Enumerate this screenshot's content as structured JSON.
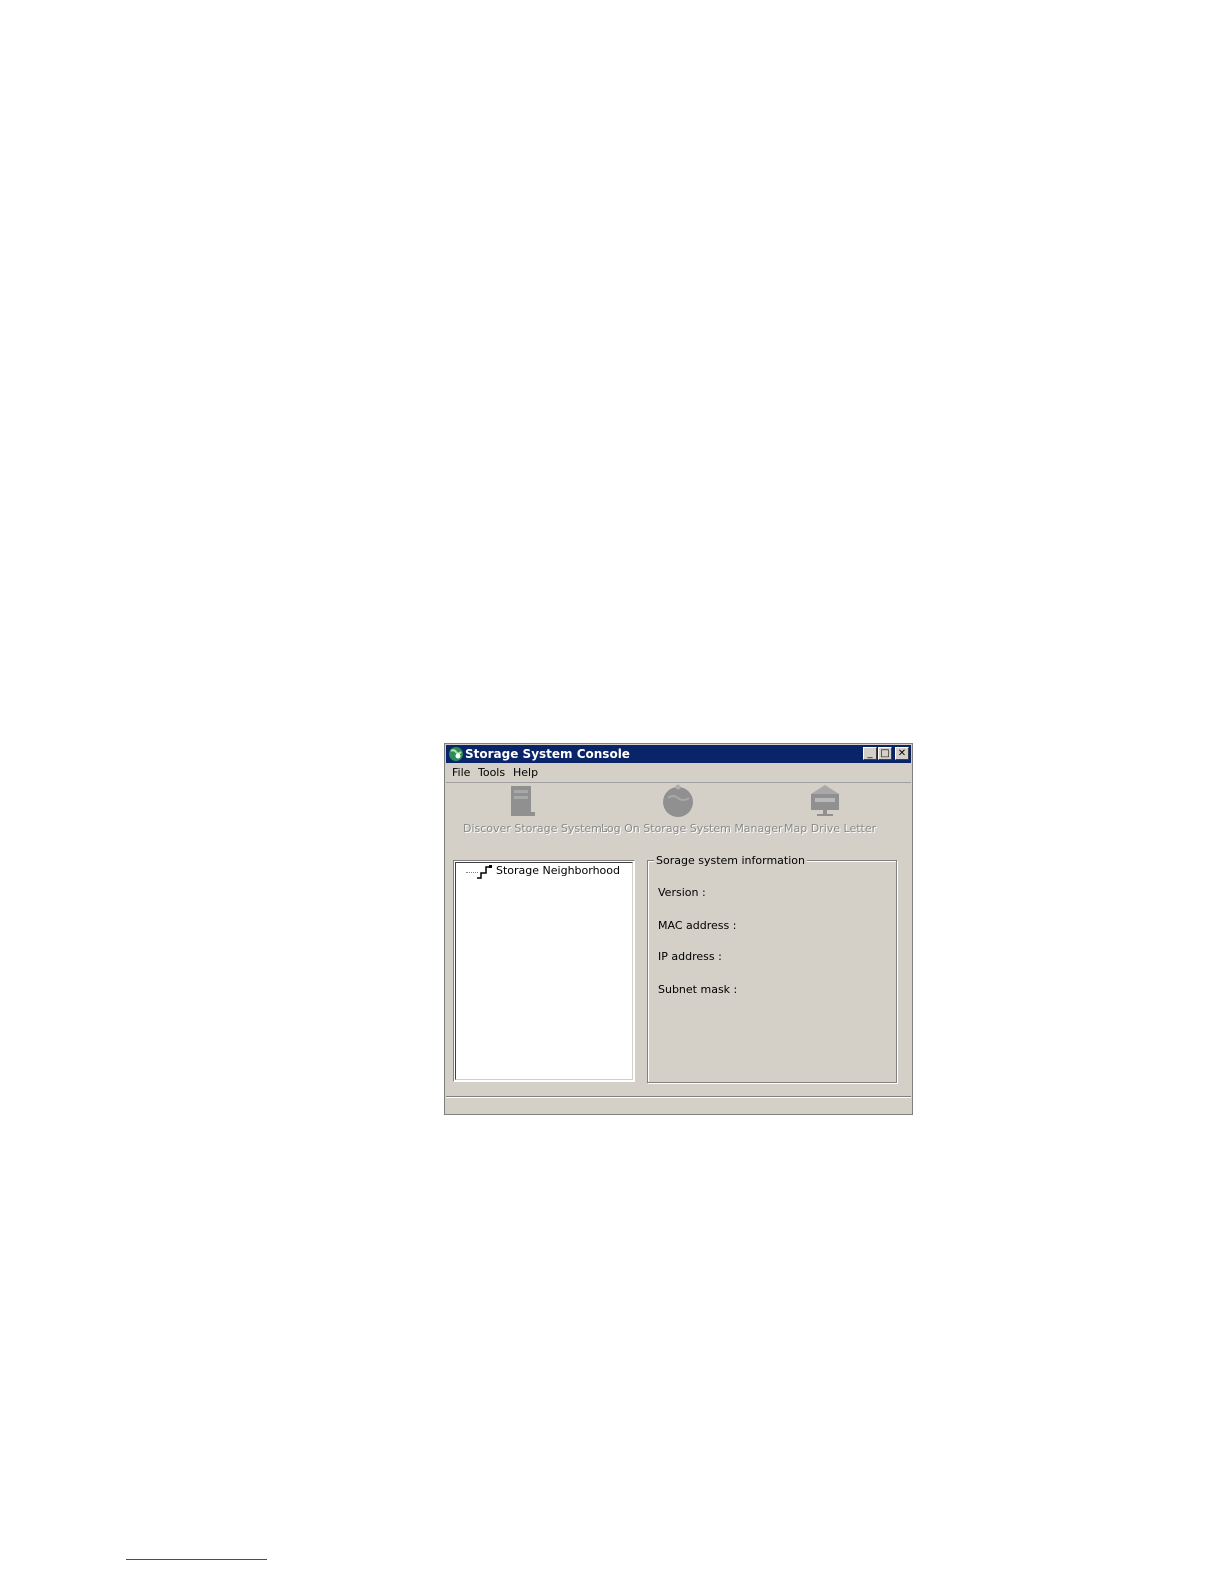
{
  "window": {
    "title": "Storage System Console",
    "controls": {
      "minimize": "_",
      "maximize": "□",
      "close": "✕"
    }
  },
  "menu": {
    "items": [
      {
        "label": "File"
      },
      {
        "label": "Tools"
      },
      {
        "label": "Help"
      }
    ]
  },
  "toolbar": {
    "discover_label": "Discover Storage Systems",
    "logon_label": "Log On Storage System Manager",
    "map_label": "Map Drive Letter"
  },
  "tree": {
    "root_label": "Storage Neighborhood"
  },
  "info": {
    "legend": "Sorage system information",
    "version_label": "Version :",
    "mac_label": "MAC address :",
    "ip_label": "IP address :",
    "subnet_label": "Subnet mask :"
  },
  "colors": {
    "titlebar": "#0a246a",
    "window_bg": "#d4d0c8",
    "disabled_text": "#8a8a8a"
  }
}
